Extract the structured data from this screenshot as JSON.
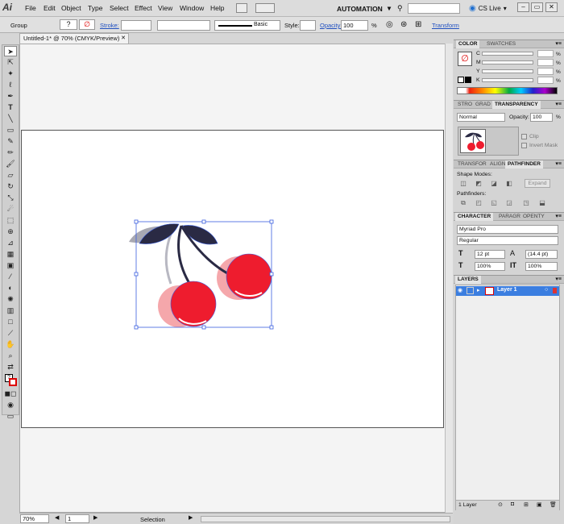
{
  "app": {
    "logo": "Ai"
  },
  "menu": [
    "File",
    "Edit",
    "Object",
    "Type",
    "Select",
    "Effect",
    "View",
    "Window",
    "Help"
  ],
  "workspace": "AUTOMATION",
  "cslive": "CS Live",
  "window_buttons": [
    "–",
    "▭",
    "✕"
  ],
  "control": {
    "selection": "Group",
    "stroke_label": "Stroke:",
    "brush_label": "Basic",
    "style_label": "Style:",
    "opacity_label": "Opacity:",
    "opacity_value": "100",
    "opacity_unit": "%",
    "transform_label": "Transform"
  },
  "document": {
    "tab": "Untitled-1* @ 70% (CMYK/Preview)",
    "close": "✕"
  },
  "status": {
    "zoom": "70%",
    "page": "1",
    "mode": "Selection"
  },
  "colors": {
    "cherry": "#ee1c2e",
    "cherry_shadow": "#f5a7ab",
    "leaf": "#2a2a44",
    "leaf_shadow": "#a8a8b2",
    "selection": "#3b5fe0"
  },
  "color_panel": {
    "tabs": [
      "COLOR",
      "SWATCHES"
    ],
    "channels": [
      "C",
      "M",
      "Y",
      "K"
    ],
    "unit": "%"
  },
  "transparency_panel": {
    "tabs": [
      "STRO",
      "GRAD",
      "TRANSPARENCY"
    ],
    "blend_mode": "Normal",
    "opacity_label": "Opacity:",
    "opacity_value": "100",
    "unit": "%",
    "clip": "Clip",
    "invert_mask": "Invert Mask"
  },
  "pathfinder_panel": {
    "tabs": [
      "TRANSFOR",
      "ALIGN",
      "PATHFINDER"
    ],
    "shape_modes": "Shape Modes:",
    "expand": "Expand",
    "pathfinders": "Pathfinders:"
  },
  "character_panel": {
    "tabs": [
      "CHARACTER",
      "PARAGR",
      "OPENTY"
    ],
    "font": "Myriad Pro",
    "style": "Regular",
    "size": "12 pt",
    "leading": "(14.4 pt)",
    "hscale": "100%",
    "vscale": "100%"
  },
  "layers_panel": {
    "tab": "LAYERS",
    "layer_name": "Layer 1",
    "footer": "1 Layer"
  }
}
